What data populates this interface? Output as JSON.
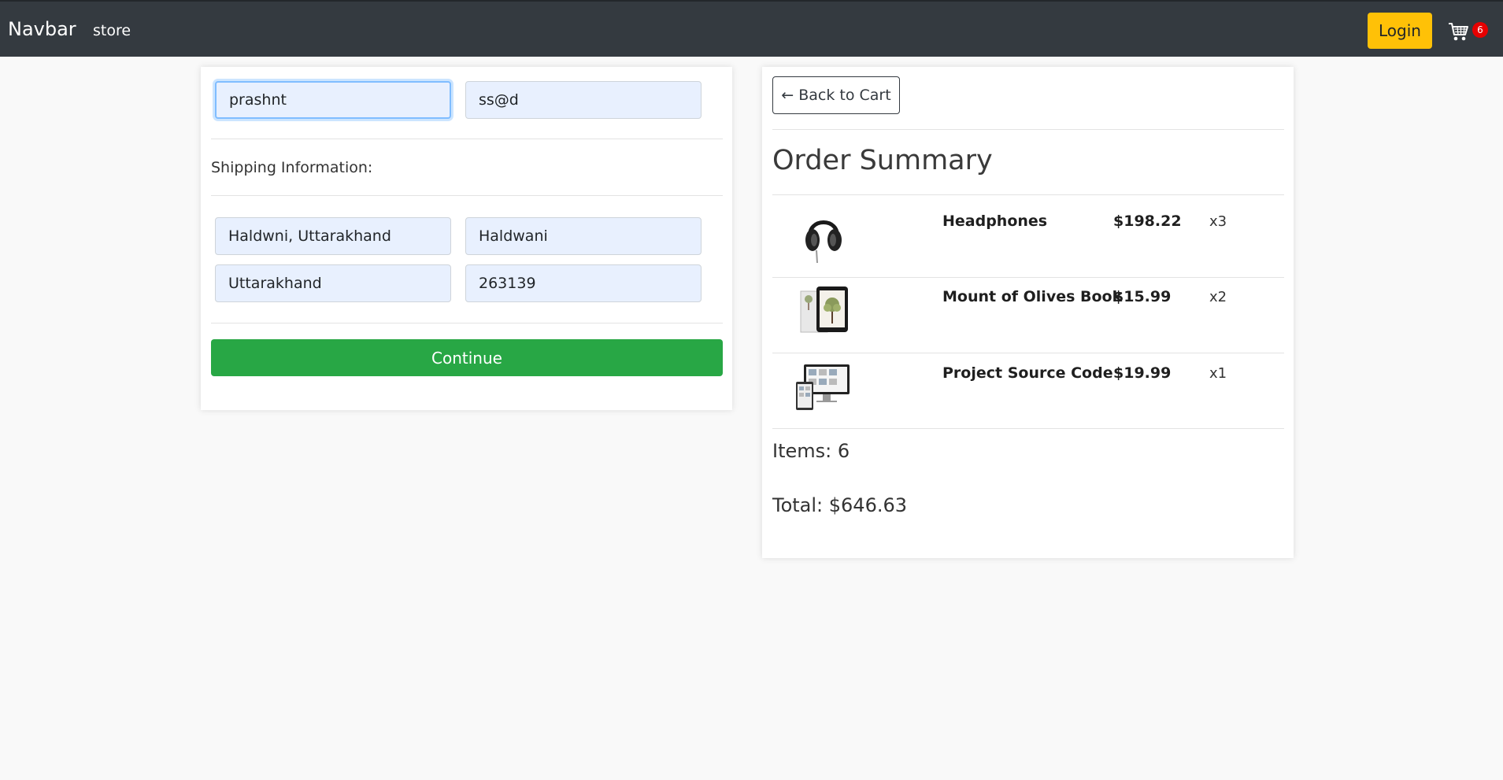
{
  "navbar": {
    "brand": "Navbar",
    "link_store": "store",
    "login_label": "Login",
    "cart_count": "6"
  },
  "form": {
    "name_value": "prashnt",
    "email_value": "ss@d",
    "shipping_label": "Shipping Information:",
    "address_value": "Haldwni, Uttarakhand",
    "city_value": "Haldwani",
    "state_value": "Uttarakhand",
    "zip_value": "263139",
    "continue_label": "Continue"
  },
  "summary": {
    "back_label": "← Back to Cart",
    "title": "Order Summary",
    "items": [
      {
        "name": "Headphones",
        "price": "$198.22",
        "qty": "x3",
        "image": "headphones-image"
      },
      {
        "name": "Mount of Olives Book",
        "price": "$15.99",
        "qty": "x2",
        "image": "book-tablet-image"
      },
      {
        "name": "Project Source Code",
        "price": "$19.99",
        "qty": "x1",
        "image": "source-code-devices-image"
      }
    ],
    "items_count": "Items: 6",
    "total": "Total: $646.63"
  },
  "colors": {
    "navbar_bg": "#343a40",
    "login_bg": "#ffc107",
    "continue_bg": "#28a745",
    "cart_badge": "#e60000",
    "input_bg": "#e8f0fe"
  }
}
